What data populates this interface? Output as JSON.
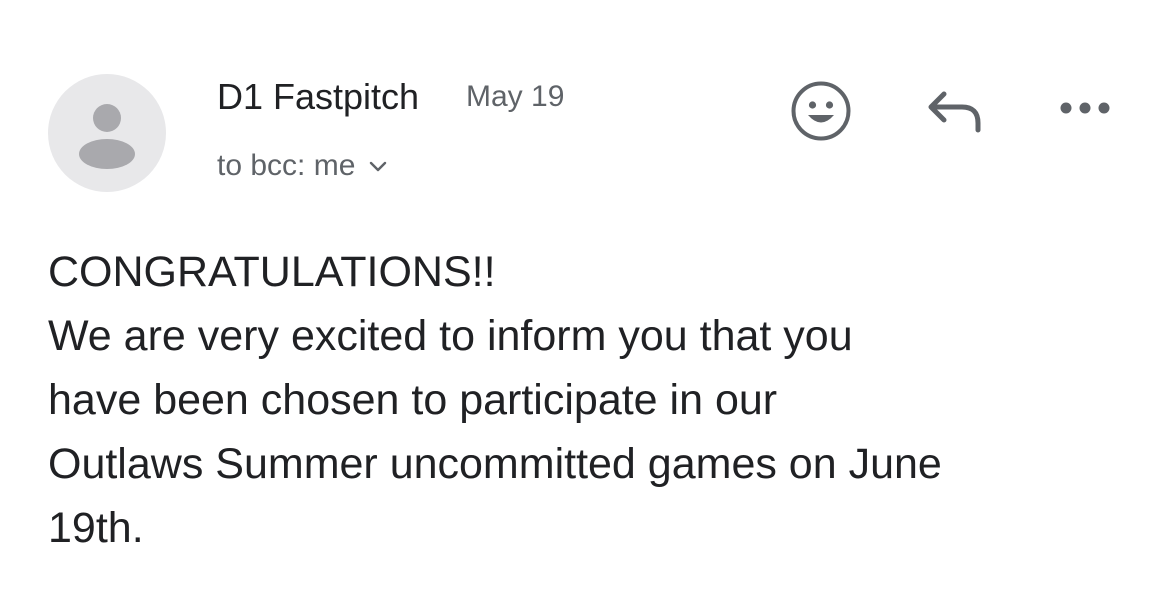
{
  "email": {
    "sender_name": "D1 Fastpitch",
    "date": "May 19",
    "recipients": "to bcc: me",
    "body_lines": [
      "CONGRATULATIONS!!",
      "We are very excited to inform you that you",
      "have been chosen to participate in our",
      "Outlaws Summer uncommitted games on June",
      "19th."
    ]
  },
  "icons": {
    "avatar": "person-avatar-icon",
    "recipients_expand": "chevron-down-icon",
    "react": "smiley-emoji-icon",
    "reply": "reply-arrow-icon",
    "more": "more-options-icon"
  },
  "colors": {
    "primary_text": "#202124",
    "secondary_text": "#5f6368",
    "avatar_bg": "#e8e8ea",
    "avatar_fg": "#a9a9ad",
    "icon_gray": "#5f6368"
  }
}
